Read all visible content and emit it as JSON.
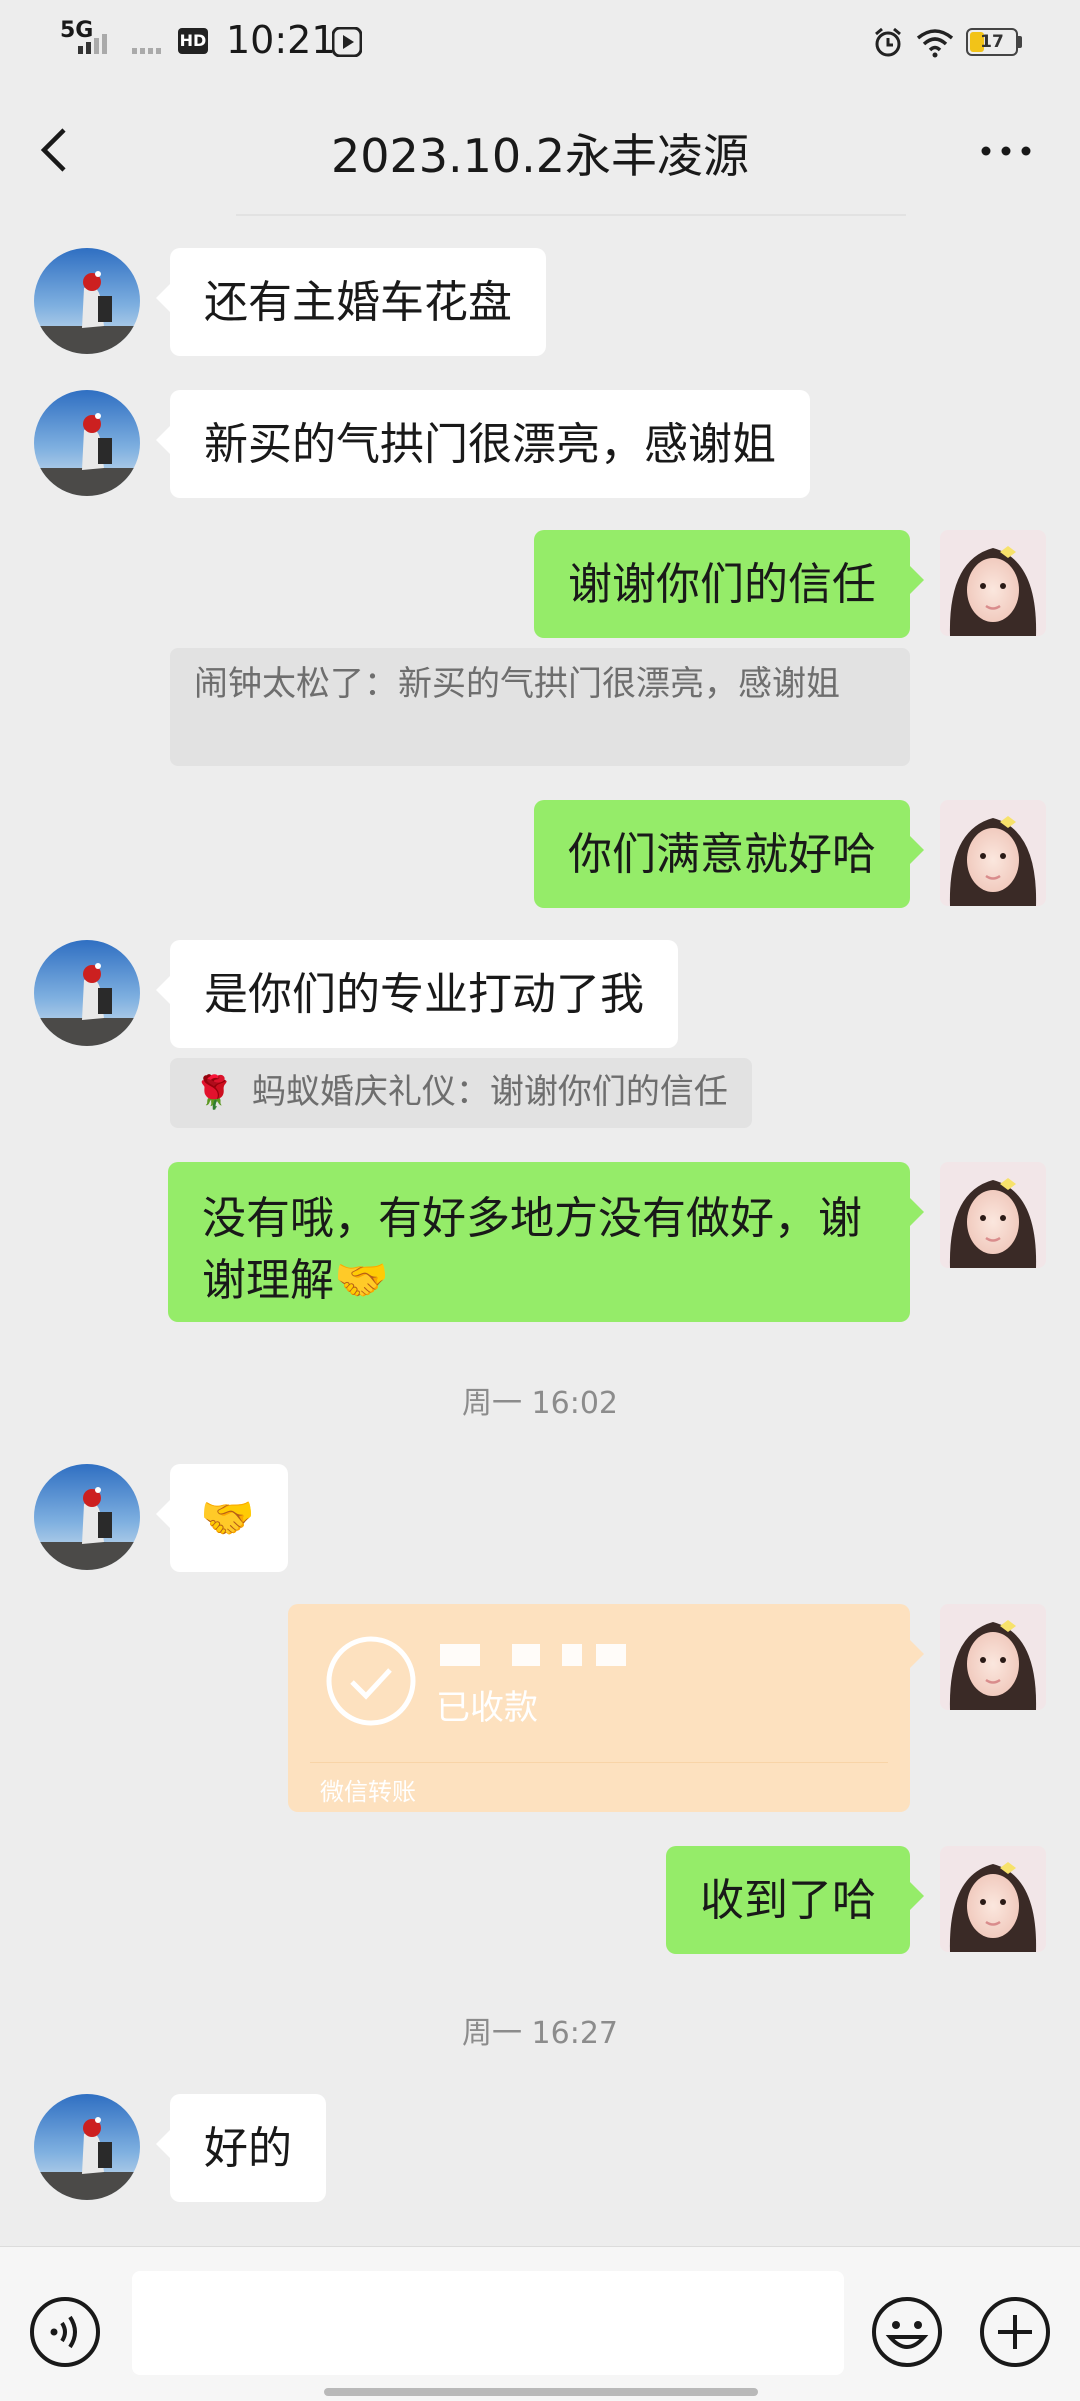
{
  "status_bar": {
    "network": "5G",
    "hd": "HD",
    "time": "10:21",
    "battery": "17"
  },
  "header": {
    "title": "2023.10.2永丰凌源"
  },
  "messages": {
    "m1": "还有主婚车花盘",
    "m2": "新买的气拱门很漂亮，感谢姐",
    "m3": "谢谢你们的信任",
    "q1": "闹钟太松了：新买的气拱门很漂亮，感谢姐",
    "m4": "你们满意就好哈",
    "m5": "是你们的专业打动了我",
    "q2_emoji": "🌹",
    "q2": "蚂蚁婚庆礼仪：谢谢你们的信任",
    "m6": "没有哦，有好多地方没有做好，谢谢理解🤝",
    "ts1": "周一 16:02",
    "m7": "🤝",
    "transfer_status": "已收款",
    "transfer_label": "微信转账",
    "m8": "收到了哈",
    "ts2": "周一 16:27",
    "m9": "好的"
  },
  "input": {
    "placeholder": ""
  }
}
